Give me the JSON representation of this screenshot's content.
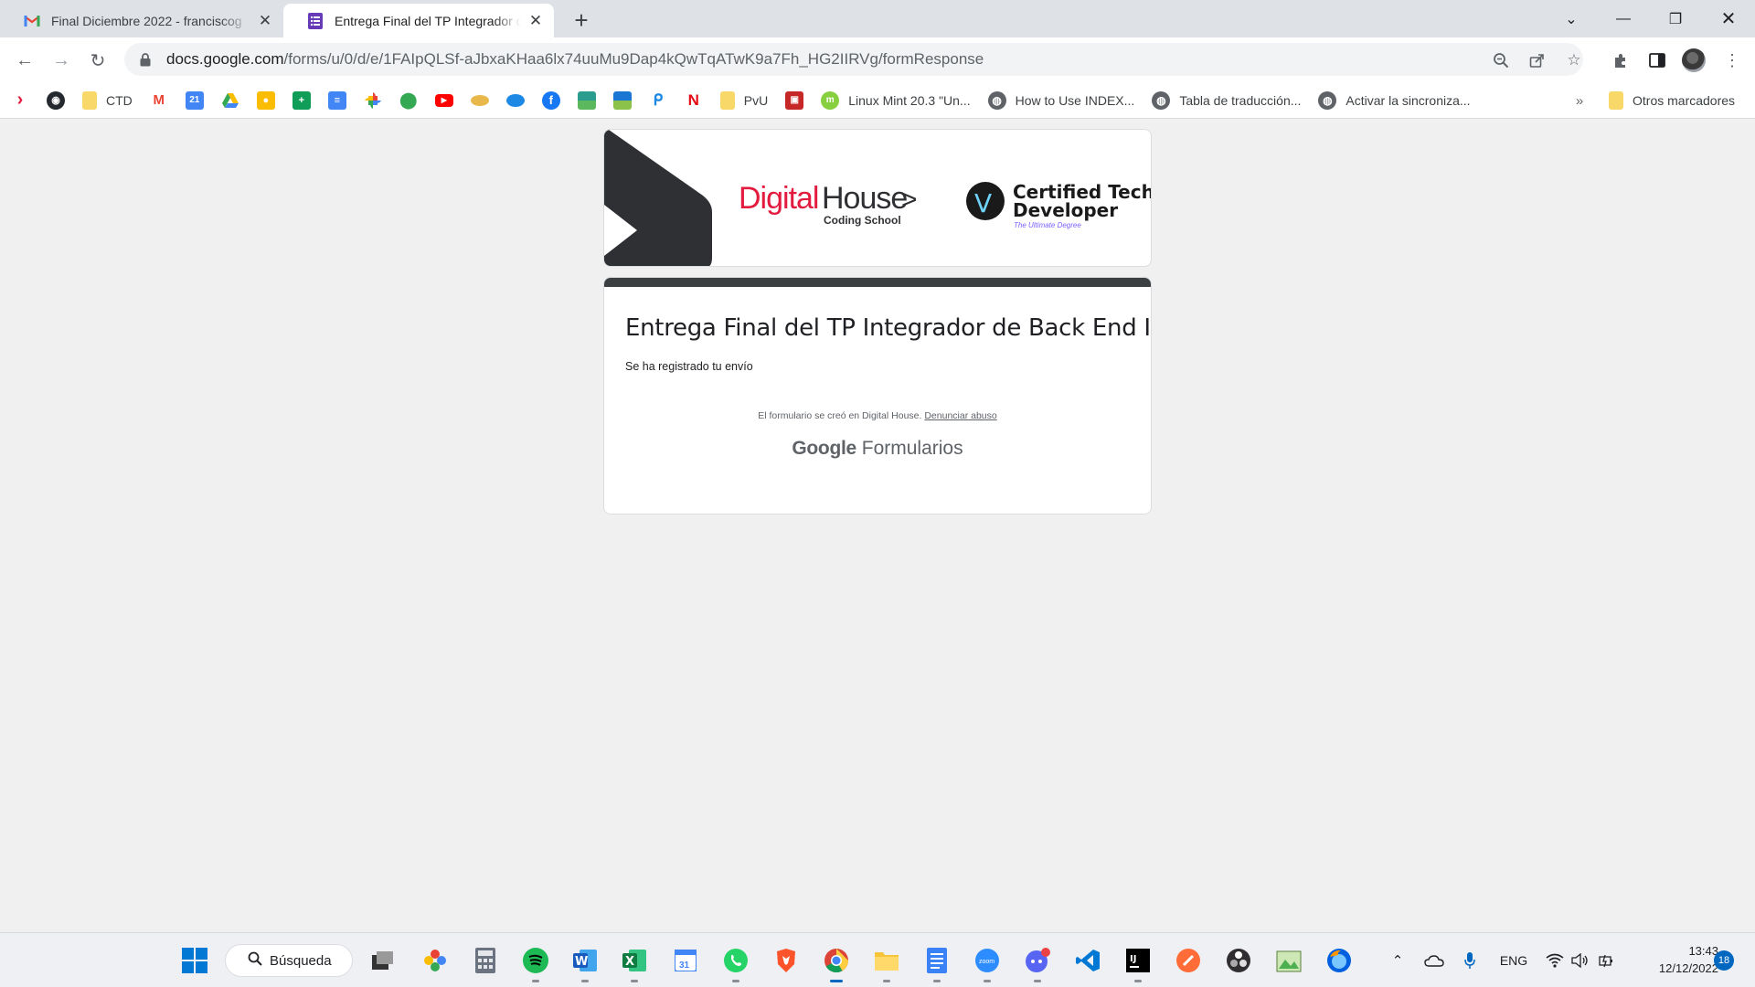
{
  "browser": {
    "tabs": [
      {
        "title": "Final Diciembre 2022 - franciscog"
      },
      {
        "title": "Entrega Final del TP Integrador de Back End I"
      }
    ],
    "url_host": "docs.google.com",
    "url_path": "/forms/u/0/d/e/1FAIpQLSf-aJbxaKHaa6lx74uuMu9Dap4kQwTqATwK9a7Fh_HG2IIRVg/formResponse"
  },
  "bookmarks": {
    "items": [
      {
        "icon": "arrow-red-icon",
        "label": ""
      },
      {
        "icon": "github-icon",
        "label": ""
      },
      {
        "icon": "folder-icon",
        "label": "CTD"
      },
      {
        "icon": "gmail-icon",
        "label": ""
      },
      {
        "icon": "calendar-icon",
        "label": ""
      },
      {
        "icon": "drive-icon",
        "label": ""
      },
      {
        "icon": "keep-icon",
        "label": ""
      },
      {
        "icon": "sheets-icon",
        "label": ""
      },
      {
        "icon": "docs-icon",
        "label": ""
      },
      {
        "icon": "photos-icon",
        "label": ""
      },
      {
        "icon": "maps-icon",
        "label": ""
      },
      {
        "icon": "youtube-icon",
        "label": ""
      },
      {
        "icon": "food-icon",
        "label": ""
      },
      {
        "icon": "cloud-icon",
        "label": ""
      },
      {
        "icon": "facebook-icon",
        "label": ""
      },
      {
        "icon": "landscape-icon",
        "label": ""
      },
      {
        "icon": "landscape-icon-2",
        "label": ""
      },
      {
        "icon": "pin-icon",
        "label": ""
      },
      {
        "icon": "netflix-icon",
        "label": ""
      },
      {
        "icon": "folder-icon-2",
        "label": "PvU"
      },
      {
        "icon": "truck-icon",
        "label": ""
      },
      {
        "icon": "linux-mint-icon",
        "label": "Linux Mint 20.3 \"Un..."
      },
      {
        "icon": "globe-icon",
        "label": "How to Use INDEX..."
      },
      {
        "icon": "globe-icon-2",
        "label": "Tabla de traducción..."
      },
      {
        "icon": "globe-icon-3",
        "label": "Activar la sincroniza..."
      }
    ],
    "more": "»",
    "other_folder": "Otros marcadores"
  },
  "banner": {
    "brand_digital": "Digital",
    "brand_house": "House",
    "brand_chevron": ">",
    "brand_sub": "Coding School",
    "ctd_title_1": "Certified Tech",
    "ctd_title_2": "Developer",
    "ctd_sub": "The Ultimate Degree",
    "ctd_mark": "V"
  },
  "form": {
    "title": "Entrega Final del TP Integrador de Back End I",
    "message": "Se ha registrado tu envío",
    "footnote": "El formulario se creó en Digital House.",
    "report_link": "Denunciar abuso",
    "google": "Google",
    "product": "Formularios"
  },
  "taskbar": {
    "search_label": "Búsqueda",
    "language": "ENG",
    "time": "13:43",
    "date": "12/12/2022",
    "notifications": "18"
  },
  "colors": {
    "dh_red": "#e31b3f",
    "ctd_dark": "#1a1a1a",
    "ctd_accent": "#7b61ff",
    "card_bar": "#3c3f42"
  }
}
